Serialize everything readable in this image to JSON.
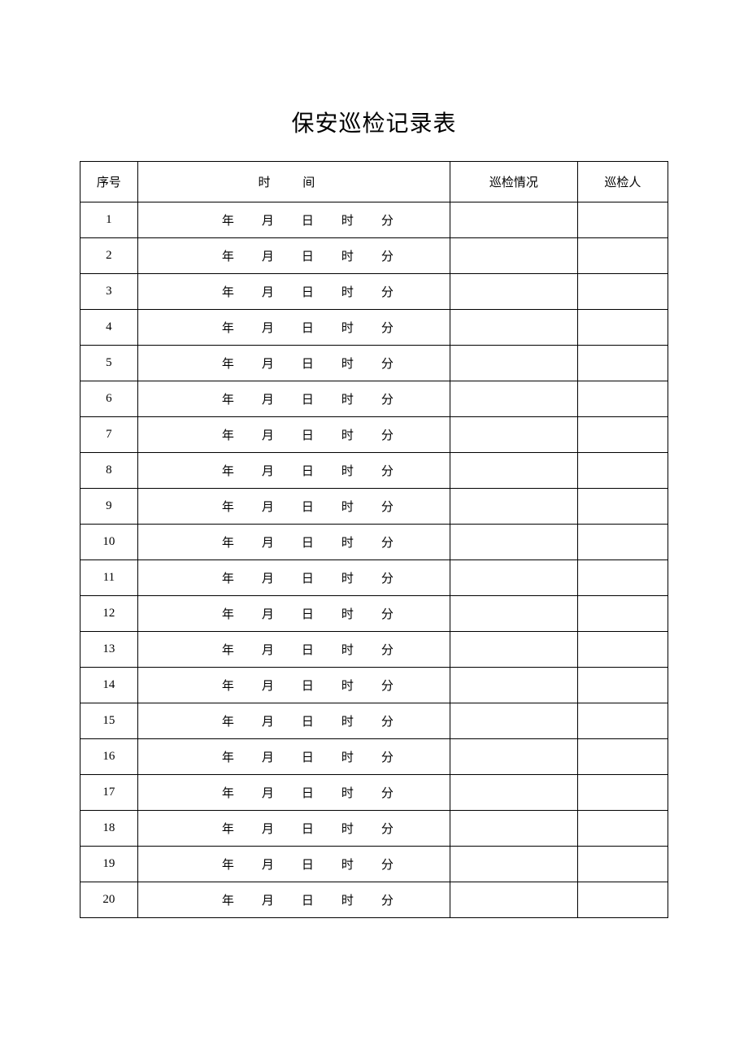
{
  "title": "保安巡检记录表",
  "headers": {
    "seq": "序号",
    "time": "时 间",
    "situation": "巡检情况",
    "person": "巡检人"
  },
  "time_units": {
    "year": "年",
    "month": "月",
    "day": "日",
    "hour": "时",
    "minute": "分"
  },
  "rows": [
    {
      "seq": "1",
      "year": "",
      "month": "",
      "day": "",
      "hour": "",
      "minute": "",
      "situation": "",
      "person": ""
    },
    {
      "seq": "2",
      "year": "",
      "month": "",
      "day": "",
      "hour": "",
      "minute": "",
      "situation": "",
      "person": ""
    },
    {
      "seq": "3",
      "year": "",
      "month": "",
      "day": "",
      "hour": "",
      "minute": "",
      "situation": "",
      "person": ""
    },
    {
      "seq": "4",
      "year": "",
      "month": "",
      "day": "",
      "hour": "",
      "minute": "",
      "situation": "",
      "person": ""
    },
    {
      "seq": "5",
      "year": "",
      "month": "",
      "day": "",
      "hour": "",
      "minute": "",
      "situation": "",
      "person": ""
    },
    {
      "seq": "6",
      "year": "",
      "month": "",
      "day": "",
      "hour": "",
      "minute": "",
      "situation": "",
      "person": ""
    },
    {
      "seq": "7",
      "year": "",
      "month": "",
      "day": "",
      "hour": "",
      "minute": "",
      "situation": "",
      "person": ""
    },
    {
      "seq": "8",
      "year": "",
      "month": "",
      "day": "",
      "hour": "",
      "minute": "",
      "situation": "",
      "person": ""
    },
    {
      "seq": "9",
      "year": "",
      "month": "",
      "day": "",
      "hour": "",
      "minute": "",
      "situation": "",
      "person": ""
    },
    {
      "seq": "10",
      "year": "",
      "month": "",
      "day": "",
      "hour": "",
      "minute": "",
      "situation": "",
      "person": ""
    },
    {
      "seq": "11",
      "year": "",
      "month": "",
      "day": "",
      "hour": "",
      "minute": "",
      "situation": "",
      "person": ""
    },
    {
      "seq": "12",
      "year": "",
      "month": "",
      "day": "",
      "hour": "",
      "minute": "",
      "situation": "",
      "person": ""
    },
    {
      "seq": "13",
      "year": "",
      "month": "",
      "day": "",
      "hour": "",
      "minute": "",
      "situation": "",
      "person": ""
    },
    {
      "seq": "14",
      "year": "",
      "month": "",
      "day": "",
      "hour": "",
      "minute": "",
      "situation": "",
      "person": ""
    },
    {
      "seq": "15",
      "year": "",
      "month": "",
      "day": "",
      "hour": "",
      "minute": "",
      "situation": "",
      "person": ""
    },
    {
      "seq": "16",
      "year": "",
      "month": "",
      "day": "",
      "hour": "",
      "minute": "",
      "situation": "",
      "person": ""
    },
    {
      "seq": "17",
      "year": "",
      "month": "",
      "day": "",
      "hour": "",
      "minute": "",
      "situation": "",
      "person": ""
    },
    {
      "seq": "18",
      "year": "",
      "month": "",
      "day": "",
      "hour": "",
      "minute": "",
      "situation": "",
      "person": ""
    },
    {
      "seq": "19",
      "year": "",
      "month": "",
      "day": "",
      "hour": "",
      "minute": "",
      "situation": "",
      "person": ""
    },
    {
      "seq": "20",
      "year": "",
      "month": "",
      "day": "",
      "hour": "",
      "minute": "",
      "situation": "",
      "person": ""
    }
  ]
}
